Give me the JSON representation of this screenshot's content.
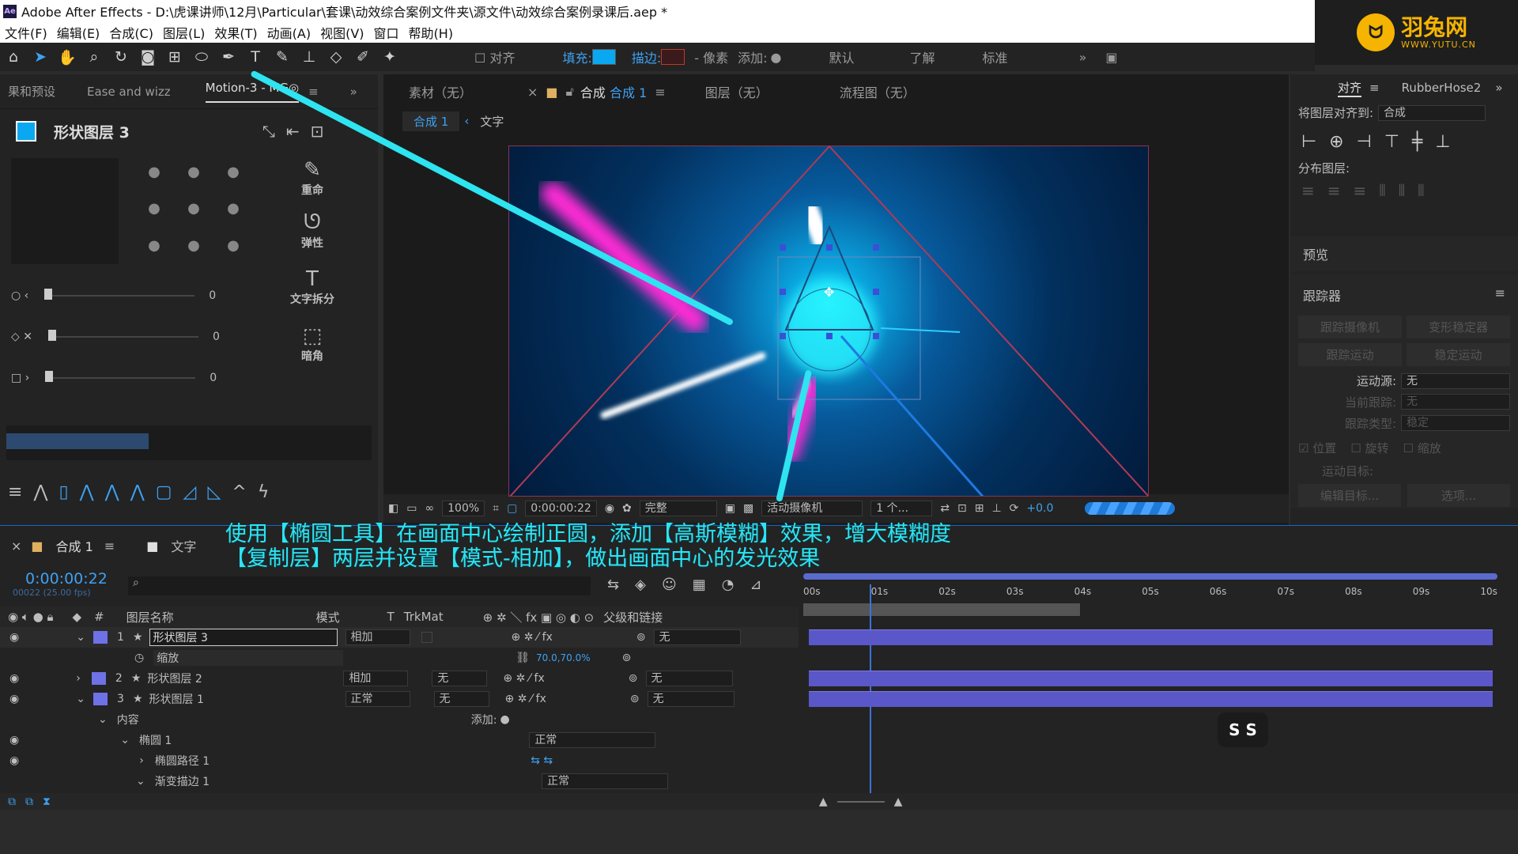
{
  "window": {
    "title": "Adobe After Effects - D:\\虎课讲师\\12月\\Particular\\套课\\动效综合案例文件夹\\源文件\\动效综合案例录课后.aep *",
    "logo_text": "Ae"
  },
  "menu": [
    "文件(F)",
    "编辑(E)",
    "合成(C)",
    "图层(L)",
    "效果(T)",
    "动画(A)",
    "视图(V)",
    "窗口",
    "帮助(H)"
  ],
  "brand": {
    "name": "羽兔网",
    "url": "WWW.YUTU.CN",
    "color": "#f5b400"
  },
  "toolbar": {
    "align_label": "对齐",
    "fill_label": "填充:",
    "stroke_label": "描边:",
    "pixels_label": "- 像素",
    "add_label": "添加:",
    "workspace_default": "默认",
    "workspace_learn": "了解",
    "workspace_standard": "标准",
    "fill_color": "#0aa8f0",
    "stroke_color": "#c0392b"
  },
  "left_panel": {
    "tabs": [
      "果和预设",
      "Ease and wizz",
      "Motion-3 - MG◎"
    ],
    "layer_name": "形状图层 3",
    "actions": [
      {
        "label": "重命",
        "icon": "pencil-icon"
      },
      {
        "label": "弹性",
        "icon": "spring-icon"
      },
      {
        "label": "文字拆分",
        "icon": "text-icon"
      },
      {
        "label": "暗角",
        "icon": "vignette-icon"
      }
    ],
    "sliders": [
      {
        "value": "0"
      },
      {
        "value": "0"
      },
      {
        "value": "0"
      }
    ]
  },
  "viewer": {
    "tabs": {
      "footage": "素材（无）",
      "comp_prefix": "合成",
      "comp_name": "合成 1",
      "layer": "图层（无）",
      "flow": "流程图（无）"
    },
    "breadcrumb": [
      "合成 1",
      "文字"
    ],
    "footer": {
      "zoom": "100%",
      "time": "0:00:00:22",
      "quality": "完整",
      "camera": "活动摄像机",
      "views": "1 个...",
      "exposure": "+0.0"
    }
  },
  "right_panel": {
    "tabs": [
      "对齐",
      "RubberHose2"
    ],
    "align_to_label": "将图层对齐到:",
    "align_to_value": "合成",
    "distribute_label": "分布图层:",
    "preview_label": "预览",
    "tracker_label": "跟踪器",
    "tracker_buttons": [
      "跟踪摄像机",
      "变形稳定器",
      "跟踪运动",
      "稳定运动"
    ],
    "motion_source_label": "运动源:",
    "motion_source_value": "无",
    "current_track_label": "当前跟踪:",
    "current_track_value": "无",
    "track_type_label": "跟踪类型:",
    "track_type_value": "稳定",
    "checks": [
      "位置",
      "旋转",
      "缩放"
    ],
    "motion_target_label": "运动目标:",
    "edit_target": "编辑目标...",
    "options": "选项..."
  },
  "annotation": {
    "line1": "使用【椭圆工具】在画面中心绘制正圆，添加【高斯模糊】效果，增大模糊度",
    "line2": "【复制层】两层并设置【模式-相加】，做出画面中心的发光效果"
  },
  "timeline": {
    "tabs": [
      "合成 1",
      "文字"
    ],
    "timecode": "0:00:00:22",
    "fps": "00022 (25.00 fps)",
    "columns": {
      "name": "图层名称",
      "mode": "模式",
      "t": "T",
      "trkmat": "TrkMat",
      "parent": "父级和链接"
    },
    "ruler": [
      "00s",
      "01s",
      "02s",
      "03s",
      "04s",
      "05s",
      "06s",
      "07s",
      "08s",
      "09s",
      "10s"
    ],
    "layers": [
      {
        "num": "1",
        "name": "形状图层 3",
        "mode": "相加",
        "trkmat": "",
        "parent": "无",
        "color": "#6e72e6"
      },
      {
        "num": "2",
        "name": "形状图层 2",
        "mode": "相加",
        "trkmat": "无",
        "parent": "无",
        "color": "#6e72e6"
      },
      {
        "num": "3",
        "name": "形状图层 1",
        "mode": "正常",
        "trkmat": "无",
        "parent": "无",
        "color": "#6e72e6"
      }
    ],
    "scale_label": "缩放",
    "scale_value": "70.0,70.0%",
    "contents_label": "内容",
    "add_label": "添加:",
    "ellipse_group": "椭圆 1",
    "ellipse_mode": "正常",
    "ellipse_path": "椭圆路径 1",
    "gradient_stroke": "渐变描边 1",
    "gradient_mode": "正常",
    "badge": "S S"
  }
}
